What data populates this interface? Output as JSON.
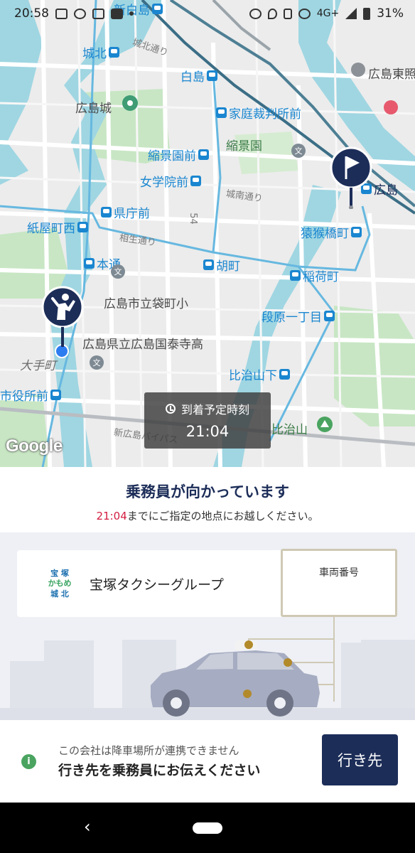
{
  "status_bar": {
    "time": "20:58",
    "network": "4G+",
    "battery": "31%"
  },
  "map": {
    "labels": {
      "shinhakushima": "新白島",
      "johoku_station": "城北",
      "johoku_dori": "城北通り",
      "hakushima": "白島",
      "hiroshima_higashi": "広島東照",
      "hiroshima_castle": "広島城",
      "katei_saibansho": "家庭裁判所前",
      "shukkeien_mae": "縮景園前",
      "shukkeien": "縮景園",
      "jogakuin_mae": "女学院前",
      "hiroshima_station": "広島",
      "jonan_dori": "城南通り",
      "kenchomae": "県庁前",
      "kamiyacho_nishi": "紙屋町西",
      "enkobashi": "猿猴橋町",
      "aioi_dori": "相生通り",
      "hondori": "本通",
      "ebisucho": "胡町",
      "inaricho": "稲荷町",
      "fukuromachi": "広島市立袋町小",
      "danbara": "段原一丁目",
      "kokutaiji": "広島県立広島国泰寺高",
      "otemachi": "大手町",
      "hijiyamashita": "比治山下",
      "shiyakusho": "市役所前",
      "hijiyama": "比治山",
      "bypass": "新広島バイパス",
      "route54": "54"
    },
    "google_logo": "Google"
  },
  "eta": {
    "label": "到着予定時刻",
    "time": "21:04"
  },
  "panel": {
    "heading": "乗務員が向かっています",
    "subtitle_time": "21:04",
    "subtitle_text": "までにご指定の地点にお越しください。"
  },
  "company": {
    "logo_lines": [
      "宝 塚",
      "かもめ",
      "城 北"
    ],
    "name": "宝塚タクシーグループ",
    "plate_label": "車両番号"
  },
  "footer": {
    "note": "この会社は降車場所が連携できません",
    "instruction": "行き先を乗務員にお伝えください",
    "destination_button": "行き先"
  },
  "colors": {
    "navy": "#1c2d58",
    "accent_red": "#d31c3f",
    "map_water": "#9fd6e2",
    "map_park": "#c8e6c4",
    "transit_blue": "#1a86d0"
  }
}
